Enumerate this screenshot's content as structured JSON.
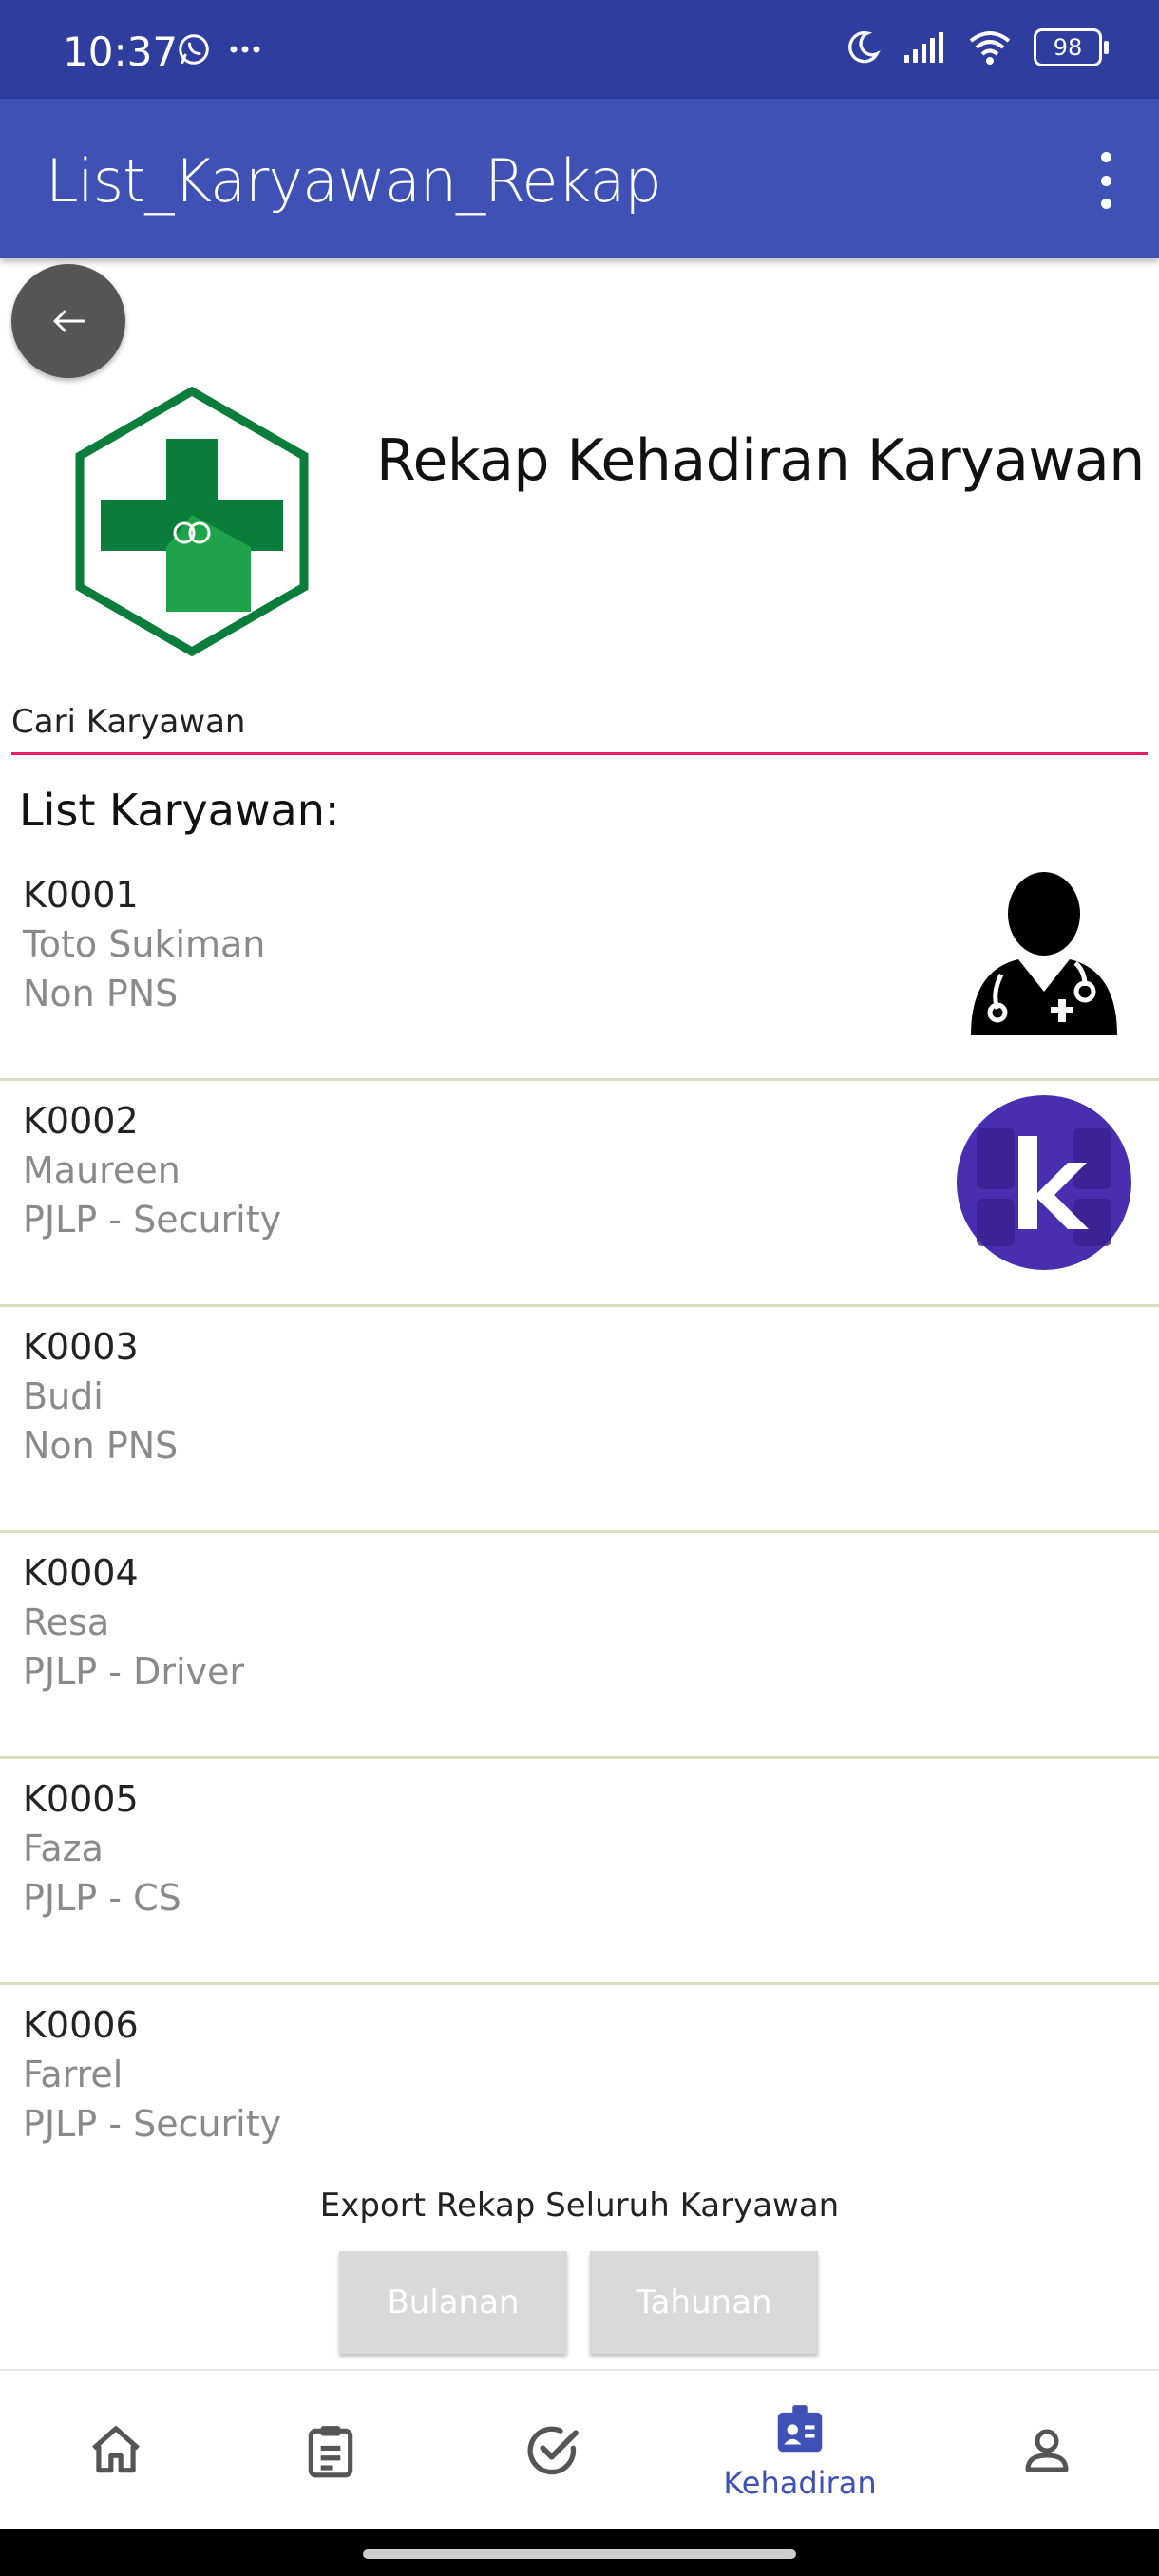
{
  "status_bar": {
    "time": "10:37",
    "battery": "98",
    "icons": [
      "whatsapp-icon",
      "more-icon",
      "moon-icon",
      "signal-icon",
      "wifi-icon",
      "battery-icon"
    ]
  },
  "app_bar": {
    "title": "List_Karyawan_Rekap",
    "menu_icon": "more-vert-icon"
  },
  "header": {
    "title": "Rekap Kehadiran Karyawan"
  },
  "search": {
    "placeholder": "Cari Karyawan"
  },
  "list": {
    "heading": "List Karyawan:",
    "items": [
      {
        "id": "K0001",
        "name": "Toto Sukiman",
        "role": "Non PNS",
        "avatar": "doctor-icon"
      },
      {
        "id": "K0002",
        "name": "Maureen",
        "role": "PJLP - Security",
        "avatar": "k-logo"
      },
      {
        "id": "K0003",
        "name": "Budi",
        "role": "Non PNS"
      },
      {
        "id": "K0004",
        "name": "Resa",
        "role": "PJLP - Driver"
      },
      {
        "id": "K0005",
        "name": "Faza",
        "role": "PJLP - CS"
      },
      {
        "id": "K0006",
        "name": "Farrel",
        "role": "PJLP - Security"
      }
    ]
  },
  "export": {
    "label": "Export Rekap Seluruh Karyawan",
    "monthly": "Bulanan",
    "yearly": "Tahunan"
  },
  "bottom_nav": {
    "items": [
      {
        "icon": "home-icon"
      },
      {
        "icon": "clipboard-icon"
      },
      {
        "icon": "check-circle-icon"
      },
      {
        "icon": "attendance-icon",
        "label": "Kehadiran",
        "active": true
      },
      {
        "icon": "person-icon"
      }
    ]
  },
  "colors": {
    "status_bar": "#2e3d9e",
    "app_bar": "#3f51b5",
    "search_underline": "#e91e63",
    "list_divider": "#d6dfc0",
    "logo_green": "#0a7d3b",
    "avatar_purple": "#4a2eb0"
  }
}
